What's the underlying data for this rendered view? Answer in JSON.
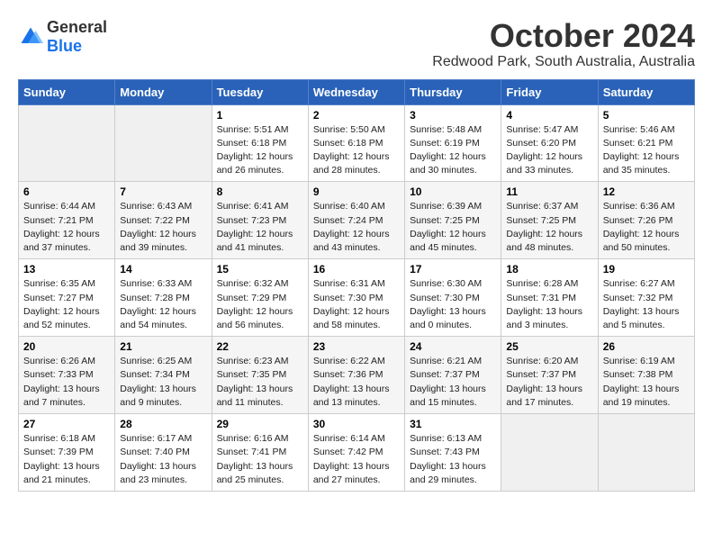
{
  "logo": {
    "general": "General",
    "blue": "Blue"
  },
  "header": {
    "title": "October 2024",
    "subtitle": "Redwood Park, South Australia, Australia"
  },
  "days_of_week": [
    "Sunday",
    "Monday",
    "Tuesday",
    "Wednesday",
    "Thursday",
    "Friday",
    "Saturday"
  ],
  "weeks": [
    [
      {
        "day": "",
        "info": ""
      },
      {
        "day": "",
        "info": ""
      },
      {
        "day": "1",
        "info": "Sunrise: 5:51 AM\nSunset: 6:18 PM\nDaylight: 12 hours\nand 26 minutes."
      },
      {
        "day": "2",
        "info": "Sunrise: 5:50 AM\nSunset: 6:18 PM\nDaylight: 12 hours\nand 28 minutes."
      },
      {
        "day": "3",
        "info": "Sunrise: 5:48 AM\nSunset: 6:19 PM\nDaylight: 12 hours\nand 30 minutes."
      },
      {
        "day": "4",
        "info": "Sunrise: 5:47 AM\nSunset: 6:20 PM\nDaylight: 12 hours\nand 33 minutes."
      },
      {
        "day": "5",
        "info": "Sunrise: 5:46 AM\nSunset: 6:21 PM\nDaylight: 12 hours\nand 35 minutes."
      }
    ],
    [
      {
        "day": "6",
        "info": "Sunrise: 6:44 AM\nSunset: 7:21 PM\nDaylight: 12 hours\nand 37 minutes."
      },
      {
        "day": "7",
        "info": "Sunrise: 6:43 AM\nSunset: 7:22 PM\nDaylight: 12 hours\nand 39 minutes."
      },
      {
        "day": "8",
        "info": "Sunrise: 6:41 AM\nSunset: 7:23 PM\nDaylight: 12 hours\nand 41 minutes."
      },
      {
        "day": "9",
        "info": "Sunrise: 6:40 AM\nSunset: 7:24 PM\nDaylight: 12 hours\nand 43 minutes."
      },
      {
        "day": "10",
        "info": "Sunrise: 6:39 AM\nSunset: 7:25 PM\nDaylight: 12 hours\nand 45 minutes."
      },
      {
        "day": "11",
        "info": "Sunrise: 6:37 AM\nSunset: 7:25 PM\nDaylight: 12 hours\nand 48 minutes."
      },
      {
        "day": "12",
        "info": "Sunrise: 6:36 AM\nSunset: 7:26 PM\nDaylight: 12 hours\nand 50 minutes."
      }
    ],
    [
      {
        "day": "13",
        "info": "Sunrise: 6:35 AM\nSunset: 7:27 PM\nDaylight: 12 hours\nand 52 minutes."
      },
      {
        "day": "14",
        "info": "Sunrise: 6:33 AM\nSunset: 7:28 PM\nDaylight: 12 hours\nand 54 minutes."
      },
      {
        "day": "15",
        "info": "Sunrise: 6:32 AM\nSunset: 7:29 PM\nDaylight: 12 hours\nand 56 minutes."
      },
      {
        "day": "16",
        "info": "Sunrise: 6:31 AM\nSunset: 7:30 PM\nDaylight: 12 hours\nand 58 minutes."
      },
      {
        "day": "17",
        "info": "Sunrise: 6:30 AM\nSunset: 7:30 PM\nDaylight: 13 hours\nand 0 minutes."
      },
      {
        "day": "18",
        "info": "Sunrise: 6:28 AM\nSunset: 7:31 PM\nDaylight: 13 hours\nand 3 minutes."
      },
      {
        "day": "19",
        "info": "Sunrise: 6:27 AM\nSunset: 7:32 PM\nDaylight: 13 hours\nand 5 minutes."
      }
    ],
    [
      {
        "day": "20",
        "info": "Sunrise: 6:26 AM\nSunset: 7:33 PM\nDaylight: 13 hours\nand 7 minutes."
      },
      {
        "day": "21",
        "info": "Sunrise: 6:25 AM\nSunset: 7:34 PM\nDaylight: 13 hours\nand 9 minutes."
      },
      {
        "day": "22",
        "info": "Sunrise: 6:23 AM\nSunset: 7:35 PM\nDaylight: 13 hours\nand 11 minutes."
      },
      {
        "day": "23",
        "info": "Sunrise: 6:22 AM\nSunset: 7:36 PM\nDaylight: 13 hours\nand 13 minutes."
      },
      {
        "day": "24",
        "info": "Sunrise: 6:21 AM\nSunset: 7:37 PM\nDaylight: 13 hours\nand 15 minutes."
      },
      {
        "day": "25",
        "info": "Sunrise: 6:20 AM\nSunset: 7:37 PM\nDaylight: 13 hours\nand 17 minutes."
      },
      {
        "day": "26",
        "info": "Sunrise: 6:19 AM\nSunset: 7:38 PM\nDaylight: 13 hours\nand 19 minutes."
      }
    ],
    [
      {
        "day": "27",
        "info": "Sunrise: 6:18 AM\nSunset: 7:39 PM\nDaylight: 13 hours\nand 21 minutes."
      },
      {
        "day": "28",
        "info": "Sunrise: 6:17 AM\nSunset: 7:40 PM\nDaylight: 13 hours\nand 23 minutes."
      },
      {
        "day": "29",
        "info": "Sunrise: 6:16 AM\nSunset: 7:41 PM\nDaylight: 13 hours\nand 25 minutes."
      },
      {
        "day": "30",
        "info": "Sunrise: 6:14 AM\nSunset: 7:42 PM\nDaylight: 13 hours\nand 27 minutes."
      },
      {
        "day": "31",
        "info": "Sunrise: 6:13 AM\nSunset: 7:43 PM\nDaylight: 13 hours\nand 29 minutes."
      },
      {
        "day": "",
        "info": ""
      },
      {
        "day": "",
        "info": ""
      }
    ]
  ]
}
